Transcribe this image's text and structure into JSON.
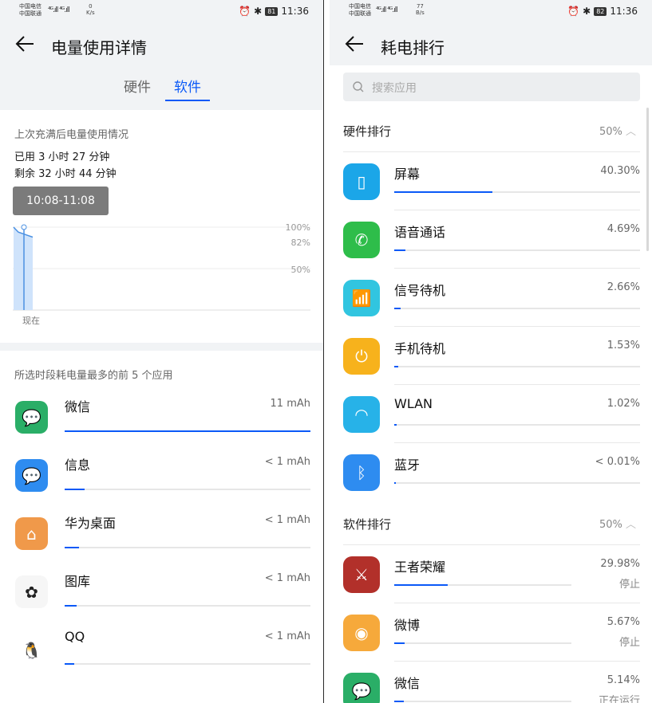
{
  "left": {
    "status": {
      "carrier1": "中国电信",
      "carrier2": "中国联通",
      "speed": "0",
      "speed_unit": "K/s",
      "battery": "81",
      "time": "11:36"
    },
    "title": "电量使用详情",
    "tabs": [
      "硬件",
      "软件"
    ],
    "active_tab": "软件",
    "usage_label": "上次充满后电量使用情况",
    "used": "已用 3 小时 27 分钟",
    "remaining": "剩余 32 小时 44 分钟",
    "time_range": "10:08-11:08",
    "chart_data": {
      "type": "area",
      "yticks": [
        "100%",
        "82%",
        "50%"
      ],
      "xlabel": "现在",
      "series": [
        {
          "values": [
            100,
            94,
            92,
            90,
            88
          ]
        }
      ],
      "ylim": [
        0,
        100
      ]
    },
    "top_apps_label": "所选时段耗电量最多的前 5 个应用",
    "apps": [
      {
        "name": "微信",
        "value": "11 mAh",
        "fraction": 1.0,
        "icon": "wechat-icon",
        "color": "#2aae67"
      },
      {
        "name": "信息",
        "value": "< 1 mAh",
        "fraction": 0.08,
        "icon": "message-icon",
        "color": "#2e8cf0"
      },
      {
        "name": "华为桌面",
        "value": "< 1 mAh",
        "fraction": 0.06,
        "icon": "home-icon",
        "color": "#f0994a"
      },
      {
        "name": "图库",
        "value": "< 1 mAh",
        "fraction": 0.05,
        "icon": "gallery-icon",
        "color": "#f6f6f6"
      },
      {
        "name": "QQ",
        "value": "< 1 mAh",
        "fraction": 0.04,
        "icon": "qq-penguin-icon",
        "color": "#ffffff"
      }
    ]
  },
  "right": {
    "status": {
      "carrier1": "中国电信",
      "carrier2": "中国联通",
      "speed": "77",
      "speed_unit": "B/s",
      "battery": "82",
      "time": "11:36"
    },
    "title": "耗电排行",
    "search_placeholder": "搜索应用",
    "hardware_label": "硬件排行",
    "hardware_total": "50%",
    "hardware": [
      {
        "name": "屏幕",
        "value": "40.30%",
        "fraction": 0.4,
        "icon": "screen-icon",
        "color": "#1ba6e8"
      },
      {
        "name": "语音通话",
        "value": "4.69%",
        "fraction": 0.047,
        "icon": "phone-icon",
        "color": "#2ebd4a"
      },
      {
        "name": "信号待机",
        "value": "2.66%",
        "fraction": 0.027,
        "icon": "signal-icon",
        "color": "#31c5e0"
      },
      {
        "name": "手机待机",
        "value": "1.53%",
        "fraction": 0.015,
        "icon": "standby-icon",
        "color": "#f7b21c"
      },
      {
        "name": "WLAN",
        "value": "1.02%",
        "fraction": 0.01,
        "icon": "wifi-icon",
        "color": "#27b2e8"
      },
      {
        "name": "蓝牙",
        "value": "< 0.01%",
        "fraction": 0.001,
        "icon": "bluetooth-icon",
        "color": "#2e8cf0"
      }
    ],
    "software_label": "软件排行",
    "software_total": "50%",
    "software": [
      {
        "name": "王者荣耀",
        "value": "29.98%",
        "status": "停止",
        "fraction": 0.3,
        "icon": "honor-of-kings-icon",
        "color": "#b2302a"
      },
      {
        "name": "微博",
        "value": "5.67%",
        "status": "停止",
        "fraction": 0.057,
        "icon": "weibo-icon",
        "color": "#f6a93b"
      },
      {
        "name": "微信",
        "value": "5.14%",
        "status": "正在运行",
        "fraction": 0.051,
        "icon": "wechat-icon",
        "color": "#2aae67"
      }
    ]
  }
}
